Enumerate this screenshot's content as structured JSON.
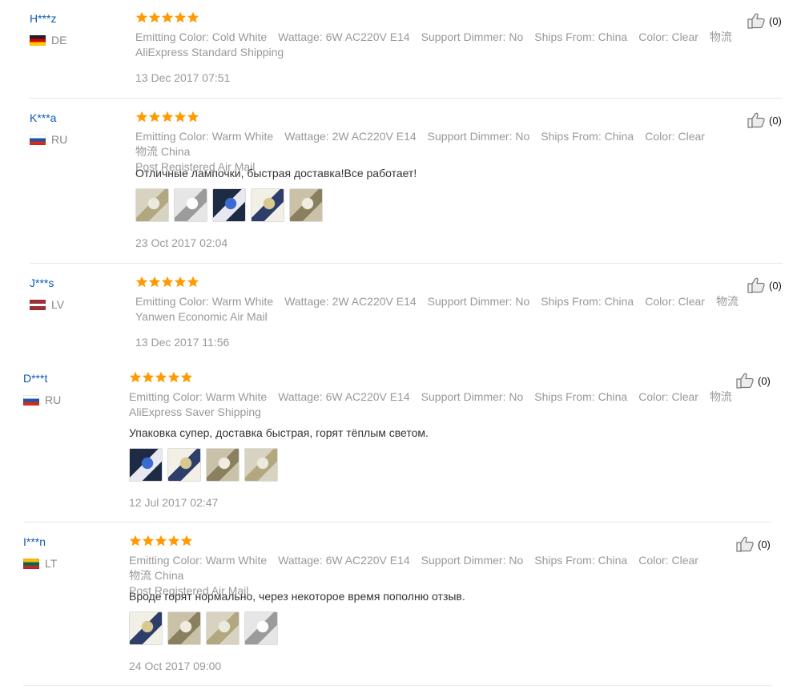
{
  "colors": {
    "username": "#0a5ab8",
    "star": "#ff9a00",
    "meta": "#999999",
    "comment": "#333333"
  },
  "reviews": [
    {
      "user": "H***z",
      "country": "DE",
      "flag": "de",
      "rating": 5,
      "attrs": [
        {
          "k": "Emitting Color:",
          "v": "Cold White"
        },
        {
          "k": "Wattage:",
          "v": "6W AC220V E14"
        },
        {
          "k": "Support Dimmer:",
          "v": "No"
        },
        {
          "k": "Ships From:",
          "v": "China"
        },
        {
          "k": "Color:",
          "v": "Clear"
        },
        {
          "k": "物流",
          "v": ""
        }
      ],
      "shipping": "AliExpress Standard Shipping",
      "comment": "",
      "photos": [],
      "date": "13 Dec 2017 07:51",
      "helpful": "(0)"
    },
    {
      "user": "K***a",
      "country": "RU",
      "flag": "ru",
      "rating": 5,
      "attrs": [
        {
          "k": "Emitting Color:",
          "v": "Warm White"
        },
        {
          "k": "Wattage:",
          "v": "2W AC220V E14"
        },
        {
          "k": "Support Dimmer:",
          "v": "No"
        },
        {
          "k": "Ships From:",
          "v": "China"
        },
        {
          "k": "Color:",
          "v": "Clear"
        },
        {
          "k": "物流",
          "v": "China"
        }
      ],
      "shipping": "Post Registered Air Mail",
      "comment": "Отличные лампочки, быстрая доставка!Все работает!",
      "photos": [
        "bulb-photo-1",
        "bulb-photo-2",
        "bulb-photo-3",
        "bulb-photo-4",
        "bulb-photo-5"
      ],
      "date": "23 Oct 2017 02:04",
      "helpful": "(0)"
    },
    {
      "user": "J***s",
      "country": "LV",
      "flag": "lv",
      "rating": 5,
      "attrs": [
        {
          "k": "Emitting Color:",
          "v": "Warm White"
        },
        {
          "k": "Wattage:",
          "v": "2W AC220V E14"
        },
        {
          "k": "Support Dimmer:",
          "v": "No"
        },
        {
          "k": "Ships From:",
          "v": "China"
        },
        {
          "k": "Color:",
          "v": "Clear"
        },
        {
          "k": "物流",
          "v": ""
        }
      ],
      "shipping": "Yanwen Economic Air Mail",
      "comment": "",
      "photos": [],
      "date": "13 Dec 2017 11:56",
      "helpful": "(0)"
    },
    {
      "user": "D***t",
      "country": "RU",
      "flag": "ru",
      "rating": 5,
      "attrs": [
        {
          "k": "Emitting Color:",
          "v": "Warm White"
        },
        {
          "k": "Wattage:",
          "v": "6W AC220V E14"
        },
        {
          "k": "Support Dimmer:",
          "v": "No"
        },
        {
          "k": "Ships From:",
          "v": "China"
        },
        {
          "k": "Color:",
          "v": "Clear"
        },
        {
          "k": "物流",
          "v": ""
        }
      ],
      "shipping": "AliExpress Saver Shipping",
      "comment": "Упаковка супер, доставка быстрая, горят тёплым светом.",
      "photos": [
        "package-photo-1",
        "package-photo-2",
        "package-photo-3",
        "package-photo-4"
      ],
      "date": "12 Jul 2017 02:47",
      "helpful": "(0)"
    },
    {
      "user": "I***n",
      "country": "LT",
      "flag": "lt",
      "rating": 5,
      "attrs": [
        {
          "k": "Emitting Color:",
          "v": "Warm White"
        },
        {
          "k": "Wattage:",
          "v": "6W AC220V E14"
        },
        {
          "k": "Support Dimmer:",
          "v": "No"
        },
        {
          "k": "Ships From:",
          "v": "China"
        },
        {
          "k": "Color:",
          "v": "Clear"
        },
        {
          "k": "物流",
          "v": "China"
        }
      ],
      "shipping": "Post Registered Air Mail",
      "comment": "Вроде горят нормально, через некоторое время пополню отзыв.",
      "photos": [
        "lamp-photo-1",
        "lamp-photo-2",
        "lamp-photo-3",
        "lamp-photo-4"
      ],
      "date": "24 Oct 2017 09:00",
      "helpful": "(0)"
    }
  ]
}
